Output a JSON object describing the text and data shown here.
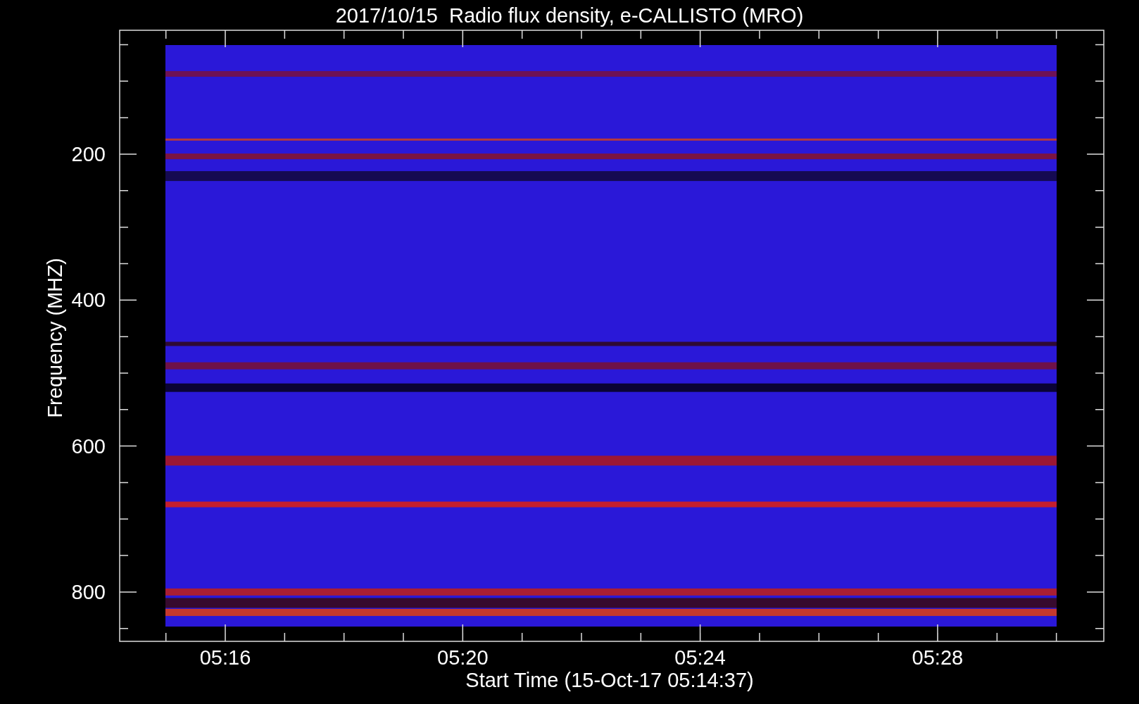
{
  "title": "2017/10/15  Radio flux density, e-CALLISTO (MRO)",
  "y_axis": {
    "label": "Frequency (MHZ)",
    "ticks": [
      "200",
      "400",
      "600",
      "800"
    ]
  },
  "x_axis": {
    "label": "Start Time (15-Oct-17 05:14:37)",
    "ticks": [
      "05:16",
      "05:20",
      "05:24",
      "05:28"
    ]
  }
}
